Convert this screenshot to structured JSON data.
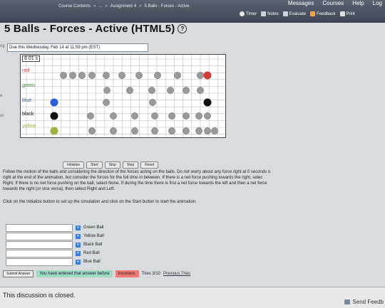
{
  "topbar": {
    "messages": "Messages",
    "courses": "Courses",
    "help": "Help",
    "logout": "Log"
  },
  "breadcrumb": [
    "Course Contents",
    "...",
    "Assignment 4",
    "5 Balls - Forces - Active"
  ],
  "toolbar": {
    "timer": "Timer",
    "notes": "Notes",
    "evaluate": "Evaluate",
    "feedback": "Feedback",
    "print": "Print"
  },
  "page": {
    "title": "5 Balls - Forces - Active (HTML5)",
    "info_symbol": "?",
    "due": "Due this Wednesday, Feb 14 at 11:59 pm (EST)"
  },
  "side_tags": [
    "ng",
    "e",
    "ot"
  ],
  "simulation": {
    "time_readout": "8.01 s",
    "rows": [
      {
        "label": "red",
        "color": "#d33a3a"
      },
      {
        "label": "green",
        "color": "#2f8a3a"
      },
      {
        "label": "blue",
        "color": "#2b5fd6"
      },
      {
        "label": "black",
        "color": "#111111"
      },
      {
        "label": "yellow",
        "color": "#9fb042"
      }
    ],
    "ball_color_gray": "#9a9a9a"
  },
  "controls": [
    "Initialize",
    "Start",
    "Stop",
    "Step",
    "Reset"
  ],
  "instructions": {
    "line1": "Follow the motion of the balls and considering the direction of the forces acting on the balls. Do not worry about any force right at 0 seconds o",
    "line2": "right at the end of the animation, but consider the forces for the full time in between. If there is a net force pushing towards the right, selec",
    "line3": "Right. If there is no net force pushing on the ball, select None. If during the time there is first a net force towards the left and then a net force",
    "line4": "towards the right (or vice versa), then select Right and Left.",
    "hint": "Click on the Initialize button to set up the simulation and click on the Start button to start the animation."
  },
  "answers": [
    {
      "label": "Green Ball",
      "value": ""
    },
    {
      "label": "Yellow Ball",
      "value": ""
    },
    {
      "label": "Black Ball",
      "value": ""
    },
    {
      "label": "Red Ball",
      "value": ""
    },
    {
      "label": "Blue Ball",
      "value": ""
    }
  ],
  "submit": {
    "button": "Submit Answer",
    "already": "You have entered that answer before",
    "incorrect": "Incorrect.",
    "tries": "Tries 3/10",
    "previous": "Previous Tries"
  },
  "discussion": {
    "closed": "This discussion is closed.",
    "send_feedback": "Send Feedb"
  }
}
